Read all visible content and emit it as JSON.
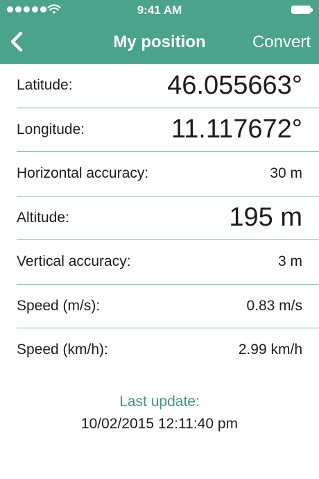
{
  "status_bar": {
    "time": "9:41 AM",
    "signal_icon": "signal-dots-icon",
    "wifi_icon": "wifi-icon",
    "battery_icon": "battery-icon"
  },
  "nav": {
    "title": "My position",
    "back_icon": "chevron-left-icon",
    "convert_label": "Convert",
    "color": "#4aa38a"
  },
  "rows": [
    {
      "label": "Latitude:",
      "value": "46.055663°",
      "big": true
    },
    {
      "label": "Longitude:",
      "value": "11.117672°",
      "big": true
    },
    {
      "label": "Horizontal accuracy:",
      "value": "30 m",
      "big": false
    },
    {
      "label": "Altitude:",
      "value": "195 m",
      "big": true
    },
    {
      "label": "Vertical accuracy:",
      "value": "3 m",
      "big": false
    },
    {
      "label": "Speed (m/s):",
      "value": "0.83 m/s",
      "big": false
    },
    {
      "label": "Speed (km/h):",
      "value": "2.99 km/h",
      "big": false
    }
  ],
  "footer": {
    "last_update_label": "Last update:",
    "last_update_value": "10/02/2015 12:11:40 pm",
    "accent_color": "#3d9a7c"
  }
}
